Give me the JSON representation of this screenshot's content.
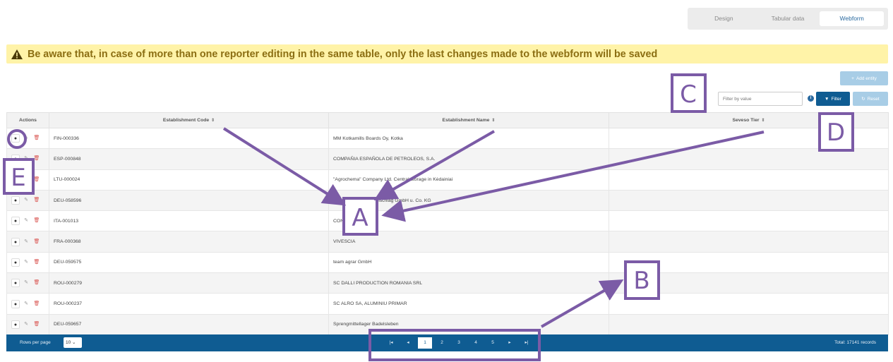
{
  "view_toggle": {
    "design": "Design",
    "tabular": "Tabular data",
    "webform": "Webform"
  },
  "warning": {
    "text": "Be aware that, in case of more than one reporter editing in the same table, only the last changes made to the webform will be saved"
  },
  "controls": {
    "add_entity": "Add entity",
    "filter_placeholder": "Filter by value",
    "filter_button": "Filter",
    "reset_button": "Reset"
  },
  "table": {
    "headers": {
      "actions": "Actions",
      "code": "Establishment Code",
      "name": "Establishment Name",
      "tier": "Seveso Tier"
    },
    "rows": [
      {
        "code": "FIN-000336",
        "name": "MM Kotkamills Boards Oy, Kotka",
        "tier": ""
      },
      {
        "code": "ESP-000848",
        "name": "COMPAÑIA ESPAÑOLA DE PETROLEOS, S.A.",
        "tier": ""
      },
      {
        "code": "LTU-000024",
        "name": "\"Agrochema\" Company Ltd. Central storage in Kėdainiai",
        "tier": ""
      },
      {
        "code": "DEU-058596",
        "name": "Logistik Spedition Umschlag GmbH u. Co. KG",
        "tier": ""
      },
      {
        "code": "ITA-001013",
        "name": "CONTARDI S.R.L.",
        "tier": ""
      },
      {
        "code": "FRA-000368",
        "name": "VIVESCIA",
        "tier": ""
      },
      {
        "code": "DEU-059575",
        "name": "team agrar GmbH",
        "tier": ""
      },
      {
        "code": "ROU-000279",
        "name": "SC DALLI PRODUCTION ROMANIA SRL",
        "tier": ""
      },
      {
        "code": "ROU-000237",
        "name": "SC ALRO SA, ALUMINIU PRIMAR",
        "tier": ""
      },
      {
        "code": "DEU-059657",
        "name": "Sprengmittellager Badelsleben",
        "tier": ""
      }
    ]
  },
  "pager": {
    "rows_label": "Rows per page",
    "rows_value": "10",
    "pages": [
      "1",
      "2",
      "3",
      "4",
      "5"
    ],
    "active_page": "1",
    "total": "Total: 17141 records"
  },
  "annotations": {
    "A": "A",
    "B": "B",
    "C": "C",
    "D": "D",
    "E": "E",
    "color": "#7b5ba6"
  },
  "colors": {
    "primary": "#0f5c92",
    "light_button": "#a8cde6",
    "warning_bg": "#fff3a8",
    "warning_text": "#8b6e12"
  }
}
